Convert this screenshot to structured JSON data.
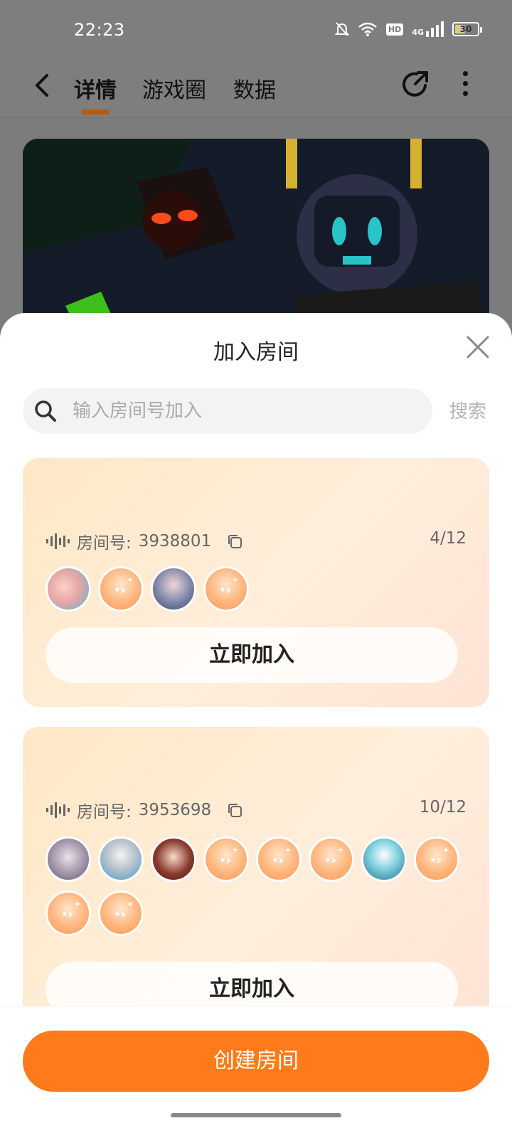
{
  "status_bar": {
    "time": "22:23",
    "hd_label": "HD",
    "network_label": "4G",
    "battery_level": "30",
    "icons": [
      "mute-bell-icon",
      "wifi-icon",
      "hd-icon",
      "signal-icon",
      "battery-icon"
    ]
  },
  "nav": {
    "tabs": [
      {
        "label": "详情",
        "active": true
      },
      {
        "label": "游戏圈",
        "active": false
      },
      {
        "label": "数据",
        "active": false
      }
    ],
    "icons": [
      "back-icon",
      "share-icon",
      "more-icon"
    ]
  },
  "sheet": {
    "title": "加入房间",
    "search": {
      "placeholder": "输入房间号加入",
      "value": "",
      "button_label": "搜索"
    },
    "rooms": [
      {
        "label": "房间号:",
        "number": "3938801",
        "count": "4/12",
        "avatars": [
          "photo",
          "default",
          "photo",
          "default"
        ],
        "join_label": "立即加入"
      },
      {
        "label": "房间号:",
        "number": "3953698",
        "count": "10/12",
        "avatars": [
          "photo",
          "photo",
          "photo",
          "default",
          "default",
          "default",
          "photo",
          "default",
          "default",
          "default"
        ],
        "join_label": "立即加入"
      }
    ],
    "create_label": "创建房间"
  },
  "colors": {
    "accent": "#ff7a1a",
    "card_gradient_start": "#ffe8c6",
    "card_gradient_end": "#ffe3d4"
  }
}
